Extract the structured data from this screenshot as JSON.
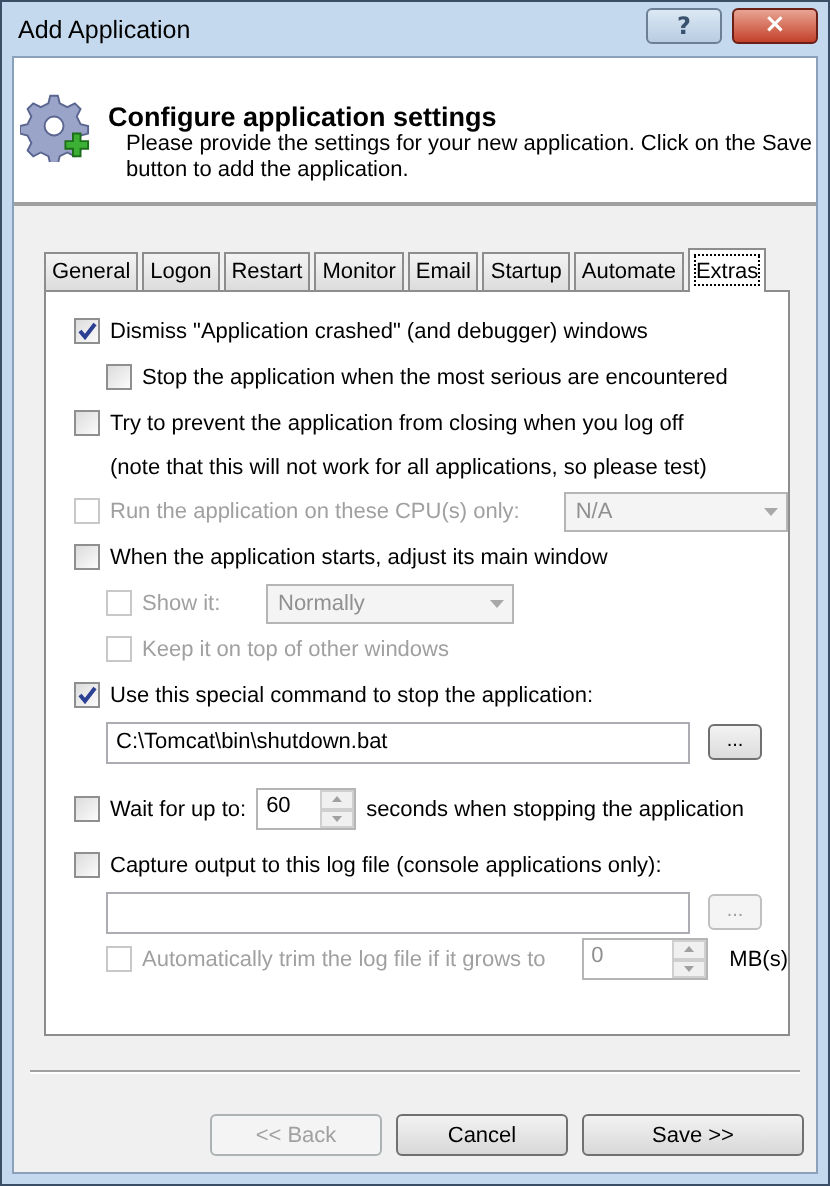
{
  "window": {
    "title": "Add Application",
    "help_button": "?",
    "close_button": "×"
  },
  "header": {
    "title": "Configure application settings",
    "description": "Please provide the settings for your new application. Click on the Save button to add the application."
  },
  "tabs": [
    {
      "label": "General",
      "selected": false
    },
    {
      "label": "Logon",
      "selected": false
    },
    {
      "label": "Restart",
      "selected": false
    },
    {
      "label": "Monitor",
      "selected": false
    },
    {
      "label": "Email",
      "selected": false
    },
    {
      "label": "Startup",
      "selected": false
    },
    {
      "label": "Automate",
      "selected": false
    },
    {
      "label": "Extras",
      "selected": true
    }
  ],
  "options": [
    {
      "kind": "check",
      "label": "Dismiss \"Application crashed\" (and debugger) windows",
      "checked": true,
      "disabled": false,
      "children": [
        {
          "kind": "check",
          "label": "Stop the application when the most serious are encountered",
          "checked": false,
          "disabled": false
        }
      ]
    },
    {
      "kind": "check",
      "label": "Try to prevent the application from closing when you log off",
      "checked": false,
      "disabled": false,
      "note": "(note that this will not work for all applications, so please test)"
    },
    {
      "kind": "dropdown",
      "label": "Run the application on these CPU(s) only:",
      "checked": false,
      "disabled": true,
      "value": "N/A"
    },
    {
      "kind": "check",
      "label": "When the application starts, adjust its main window",
      "checked": false,
      "disabled": false,
      "children": [
        {
          "kind": "dropdown",
          "label": "Show it:",
          "checked": false,
          "disabled": true,
          "value": "Normally"
        },
        {
          "kind": "check",
          "label": "Keep it on top of other windows",
          "checked": false,
          "disabled": true
        }
      ]
    },
    {
      "kind": "check",
      "label": "Use this special command to stop the application:",
      "checked": true,
      "disabled": false,
      "field": {
        "value": "C:\\Tomcat\\bin\\shutdown.bat",
        "browse": "...",
        "browse_disabled": false
      }
    },
    {
      "kind": "spin",
      "label": "Wait for up to:",
      "checked": false,
      "disabled": false,
      "value": "60",
      "suffix": "seconds when stopping the application"
    },
    {
      "kind": "check",
      "label": "Capture output to this log file (console applications only):",
      "checked": false,
      "disabled": false,
      "field": {
        "browse": "...",
        "browse_disabled": true
      },
      "children": [
        {
          "kind": "spin",
          "label": "Automatically trim the log file if it grows to",
          "checked": false,
          "disabled": true,
          "value": "0",
          "suffix": "MB(s)"
        }
      ]
    }
  ],
  "buttons": [
    {
      "label": "<< Back",
      "disabled": true
    },
    {
      "label": "Cancel",
      "disabled": false
    },
    {
      "label": "Save >>",
      "disabled": false
    }
  ]
}
